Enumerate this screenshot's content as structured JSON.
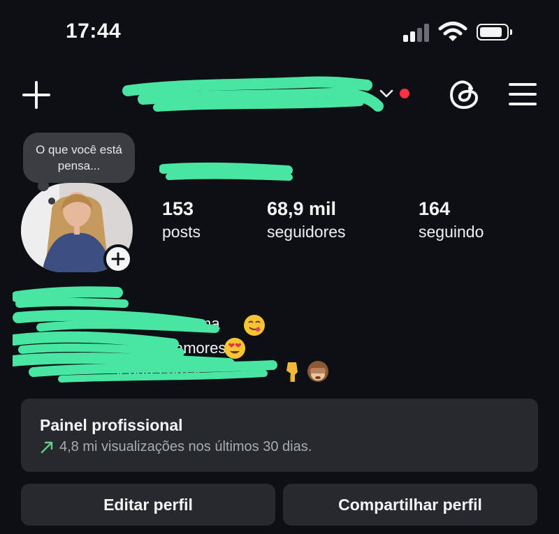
{
  "status_bar": {
    "time": "17:44",
    "signal_icon": "cellular-signal-icon",
    "wifi_icon": "wifi-icon",
    "battery_icon": "battery-icon"
  },
  "header": {
    "new_post_icon": "plus-icon",
    "account_switcher_icon": "chevron-down-icon",
    "notification_dot_color": "#ff3040",
    "threads_icon": "threads-icon",
    "menu_icon": "hamburger-menu-icon"
  },
  "profile": {
    "note_text": "O que você está pensa...",
    "add_story_icon": "plus-icon",
    "stats": [
      {
        "value": "153",
        "label": "posts"
      },
      {
        "value": "68,9 mil",
        "label": "seguidores"
      },
      {
        "value": "164",
        "label": "seguindo"
      }
    ]
  },
  "bio": {
    "line2_end": "ma",
    "line3_end": "amores",
    "line4_end": "separei pra v"
  },
  "dashboard": {
    "title": "Painel profissional",
    "subtitle": "4,8 mi visualizações nos últimos 30 dias.",
    "trend_icon": "trend-up-arrow-icon",
    "trend_color": "#5ed18a"
  },
  "actions": {
    "edit_profile": "Editar perfil",
    "share_profile": "Compartilhar perfil"
  },
  "colors": {
    "background": "#0c1014",
    "card": "#262a2f",
    "redaction": "#49e6a3"
  }
}
